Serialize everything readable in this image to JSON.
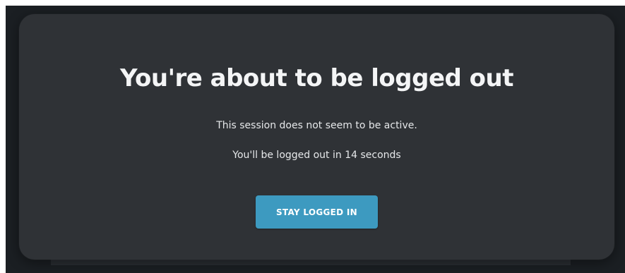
{
  "modal": {
    "title": "You're about to be logged out",
    "message": "This session does not seem to be active.",
    "countdown_prefix": "You'll be logged out in ",
    "countdown_seconds": "14",
    "countdown_suffix": " seconds",
    "stay_logged_in_label": "STAY LOGGED IN"
  },
  "colors": {
    "backdrop": "#1b1f23",
    "modal_background": "#2f3236",
    "button_accent": "#3d9ac0",
    "title_text": "#f4f5f6",
    "body_text": "#e6e8ea"
  }
}
